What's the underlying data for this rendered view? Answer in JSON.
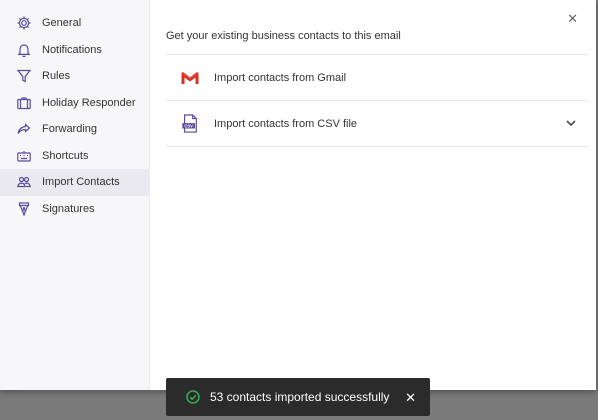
{
  "sidebar": {
    "items": [
      {
        "label": "General",
        "icon": "gear-icon"
      },
      {
        "label": "Notifications",
        "icon": "bell-icon"
      },
      {
        "label": "Rules",
        "icon": "filter-icon"
      },
      {
        "label": "Holiday Responder",
        "icon": "suitcase-icon"
      },
      {
        "label": "Forwarding",
        "icon": "forward-arrow-icon"
      },
      {
        "label": "Shortcuts",
        "icon": "keyboard-icon"
      },
      {
        "label": "Import Contacts",
        "icon": "contacts-icon"
      },
      {
        "label": "Signatures",
        "icon": "pen-nib-icon"
      }
    ],
    "active": "Import Contacts"
  },
  "main": {
    "intro": "Get your existing business contacts to this email",
    "import_options": [
      {
        "label": "Import contacts from Gmail",
        "icon": "gmail-icon"
      },
      {
        "label": "Import contacts from CSV file",
        "icon": "csv-file-icon"
      }
    ]
  },
  "toast": {
    "message": "53 contacts imported successfully"
  },
  "colors": {
    "accent": "#5b4a9b",
    "gmail_red": "#d93025",
    "success": "#34a853",
    "toast_bg": "#2b2b2b"
  }
}
